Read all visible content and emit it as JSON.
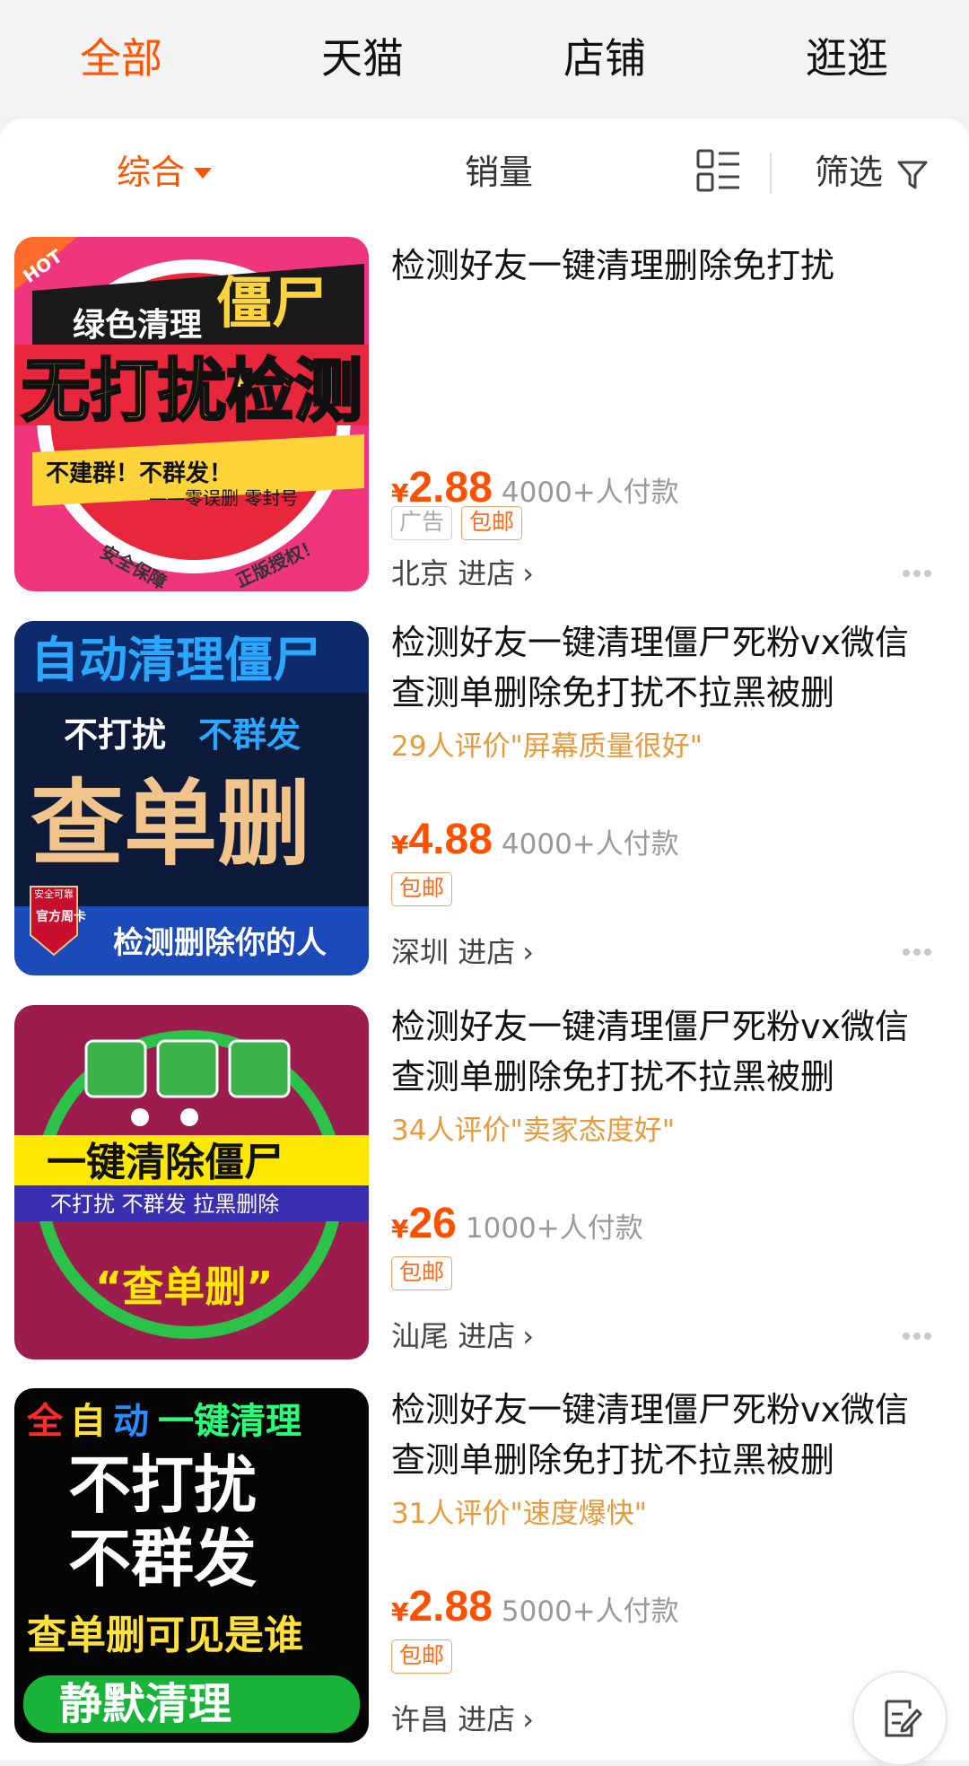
{
  "top_tabs": [
    "全部",
    "天猫",
    "店铺",
    "逛逛"
  ],
  "sort_bar": {
    "comprehensive": "综合",
    "sales": "销量",
    "filter": "筛选"
  },
  "products": [
    {
      "title": "检测好友一键清理删除免打扰",
      "review": "",
      "currency": "¥",
      "price": "2.88",
      "sales": "4000+人付款",
      "tags": [
        "广告",
        "包邮"
      ],
      "location": "北京",
      "shop_link": "进店",
      "image_text": {
        "badge": "HOT",
        "l1": "绿色清理",
        "l2": "僵尸",
        "l3": "无打扰检测",
        "l4": "不建群！不群发！",
        "l5": "——零误删 零封号",
        "l6": "安全保障",
        "l7": "正版授权！"
      }
    },
    {
      "title": "检测好友一键清理僵尸死粉vx微信查测单删除免打扰不拉黑被删",
      "review": "29人评价\"屏幕质量很好\"",
      "currency": "¥",
      "price": "4.88",
      "sales": "4000+人付款",
      "tags": [
        "包邮"
      ],
      "location": "深圳",
      "shop_link": "进店",
      "image_text": {
        "l1": "自动清理僵尸",
        "l2": "不打扰",
        "l3": "不群发",
        "l4": "查单删",
        "l5": "检测删除你的人",
        "l6": "官方周卡",
        "l7": "安全可靠"
      }
    },
    {
      "title": "检测好友一键清理僵尸死粉vx微信查测单删除免打扰不拉黑被删",
      "review": "34人评价\"卖家态度好\"",
      "currency": "¥",
      "price": "26",
      "sales": "1000+人付款",
      "tags": [
        "包邮"
      ],
      "location": "汕尾",
      "shop_link": "进店",
      "image_text": {
        "l1": "一键清除僵尸",
        "l2": "不打扰 不群发 拉黑删除",
        "l3": "“查单删”"
      }
    },
    {
      "title": "检测好友一键清理僵尸死粉vx微信查测单删除免打扰不拉黑被删",
      "review": "31人评价\"速度爆快\"",
      "currency": "¥",
      "price": "2.88",
      "sales": "5000+人付款",
      "tags": [
        "包邮"
      ],
      "location": "许昌",
      "shop_link": "进店",
      "image_text": {
        "l1a": "全",
        "l1b": "自",
        "l1c": "动",
        "l1d": "一键清理",
        "l2": "不打扰",
        "l3": "不群发",
        "l4": "查单删可见是谁",
        "l5": "静默清理"
      }
    }
  ],
  "colors": {
    "accent": "#ff5500",
    "price": "#ff5000",
    "review": "#e89a3a"
  }
}
